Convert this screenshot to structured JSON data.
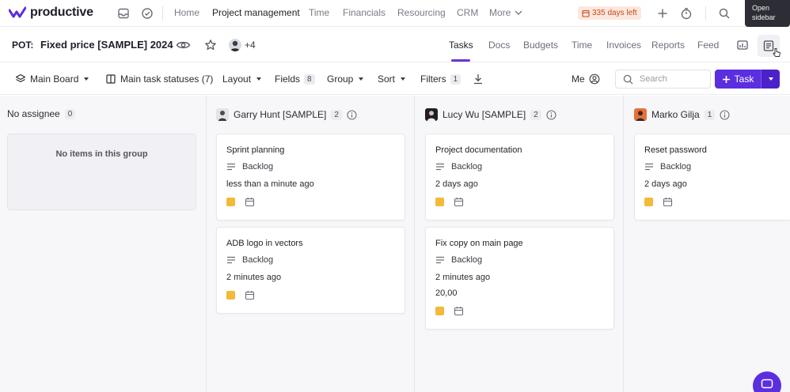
{
  "app": {
    "logo_text": "productive"
  },
  "topnav": {
    "items": [
      {
        "label": "Home",
        "active": false
      },
      {
        "label": "Project management",
        "active": true
      },
      {
        "label": "Time",
        "active": false
      },
      {
        "label": "Financials",
        "active": false
      },
      {
        "label": "Resourcing",
        "active": false
      },
      {
        "label": "CRM",
        "active": false
      },
      {
        "label": "More",
        "active": false
      }
    ],
    "trial_badge": "335 days left",
    "tooltip_line1": "Open",
    "tooltip_line2": "sidebar"
  },
  "project": {
    "code": "POT:",
    "title": "Fixed price [SAMPLE] 2024",
    "extra_members": "+4",
    "tabs": [
      {
        "label": "Tasks",
        "active": true
      },
      {
        "label": "Docs",
        "active": false
      },
      {
        "label": "Budgets",
        "active": false
      },
      {
        "label": "Time",
        "active": false
      },
      {
        "label": "Invoices",
        "active": false
      },
      {
        "label": "Reports",
        "active": false
      },
      {
        "label": "Feed",
        "active": false
      }
    ]
  },
  "toolbar": {
    "board": "Main Board",
    "statuses": "Main task statuses (7)",
    "layout": "Layout",
    "fields": "Fields",
    "fields_count": "8",
    "group": "Group",
    "sort": "Sort",
    "filters": "Filters",
    "filters_count": "1",
    "me": "Me",
    "search_placeholder": "Search",
    "add_task": "Task"
  },
  "colors": {
    "accent": "#5b2ee0",
    "priority": "#f2b93b",
    "trial_text": "#c24a1b",
    "trial_bg": "#fde8de"
  },
  "columns": [
    {
      "name": "No assignee",
      "count": "0",
      "empty_text": "No items in this group",
      "cards": []
    },
    {
      "name": "Garry Hunt [SAMPLE]",
      "count": "2",
      "cards": [
        {
          "title": "Sprint planning",
          "status": "Backlog",
          "time": "less than a minute ago"
        },
        {
          "title": "ADB logo in vectors",
          "status": "Backlog",
          "time": "2 minutes ago"
        }
      ]
    },
    {
      "name": "Lucy Wu [SAMPLE]",
      "count": "2",
      "cards": [
        {
          "title": "Project documentation",
          "status": "Backlog",
          "time": "2 days ago"
        },
        {
          "title": "Fix copy on main page",
          "status": "Backlog",
          "time": "2 minutes ago",
          "extra": "20,00"
        }
      ]
    },
    {
      "name": "Marko Gilja",
      "count": "1",
      "cards": [
        {
          "title": "Reset password",
          "status": "Backlog",
          "time": "2 days ago"
        }
      ]
    }
  ]
}
